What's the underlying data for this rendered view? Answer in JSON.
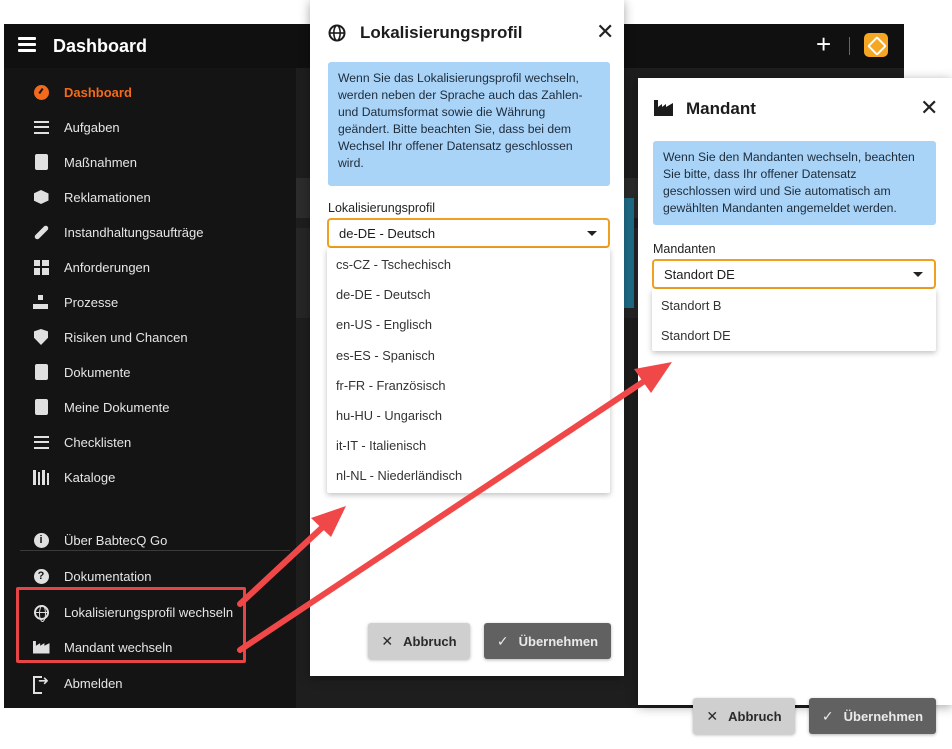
{
  "app": {
    "title": "Dashboard"
  },
  "sidebar": {
    "items": [
      {
        "label": "Dashboard",
        "icon": "dashboard-icon",
        "active": true
      },
      {
        "label": "Aufgaben",
        "icon": "tasks-icon"
      },
      {
        "label": "Maßnahmen",
        "icon": "clipboard-icon"
      },
      {
        "label": "Reklamationen",
        "icon": "box-icon"
      },
      {
        "label": "Instandhaltungsaufträge",
        "icon": "wrench-icon"
      },
      {
        "label": "Anforderungen",
        "icon": "requirements-icon"
      },
      {
        "label": "Prozesse",
        "icon": "sitemap-icon"
      },
      {
        "label": "Risiken und Chancen",
        "icon": "shield-icon"
      },
      {
        "label": "Dokumente",
        "icon": "document-check-icon"
      },
      {
        "label": "Meine Dokumente",
        "icon": "document-user-icon"
      },
      {
        "label": "Checklisten",
        "icon": "checklist-icon"
      },
      {
        "label": "Kataloge",
        "icon": "books-icon"
      }
    ],
    "footer_items": [
      {
        "label": "Über BabtecQ Go",
        "icon": "info-icon"
      },
      {
        "label": "Dokumentation",
        "icon": "help-icon"
      },
      {
        "label": "Lokalisierungsprofil wechseln",
        "icon": "globe-icon"
      },
      {
        "label": "Mandant wechseln",
        "icon": "factory-icon"
      },
      {
        "label": "Abmelden",
        "icon": "logout-icon"
      }
    ]
  },
  "locale_dialog": {
    "title": "Lokalisierungsprofil",
    "info": "Wenn Sie das Lokalisierungsprofil wechseln, werden neben der Sprache auch das Zahlen- und Datumsformat sowie die Währung geändert. Bitte beachten Sie, dass bei dem Wechsel Ihr offener Datensatz geschlossen wird.",
    "field_label": "Lokalisierungsprofil",
    "selected": "de-DE - Deutsch",
    "options": [
      "cs-CZ - Tschechisch",
      "de-DE - Deutsch",
      "en-US - Englisch",
      "es-ES - Spanisch",
      "fr-FR - Französisch",
      "hu-HU - Ungarisch",
      "it-IT - Italienisch",
      "nl-NL - Niederländisch"
    ],
    "cancel_label": "Abbruch",
    "ok_label": "Übernehmen"
  },
  "tenant_dialog": {
    "title": "Mandant",
    "info": "Wenn Sie den Mandanten wechseln, beachten Sie bitte, dass Ihr offener Datensatz geschlossen wird und Sie automatisch am gewählten Mandanten angemeldet werden.",
    "field_label": "Mandanten",
    "selected": "Standort DE",
    "options": [
      "Standort B",
      "Standort DE"
    ],
    "cancel_label": "Abbruch",
    "ok_label": "Übernehmen"
  },
  "colors": {
    "accent": "#f26a1b",
    "focus_border": "#f0a020",
    "info_bg": "#a9d3f7",
    "highlight": "#e64545",
    "sidebar_bg": "#141414"
  }
}
